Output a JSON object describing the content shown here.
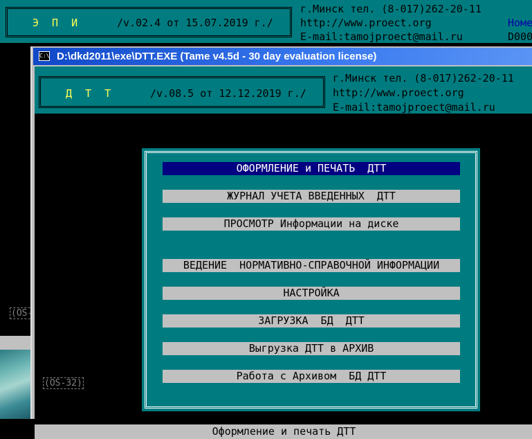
{
  "background_app": {
    "name": "Э П И",
    "version": "/v.02.4 от 15.07.2019 г./",
    "contact_lines": [
      "г.Минск тел. (8-017)262-20-11",
      "http://www.proect.org",
      "E-mail:tamojproect@mail.ru"
    ],
    "right_cut_1": "Номе",
    "right_cut_2": "D000",
    "os_label": "(OS-"
  },
  "window": {
    "title": "D:\\dkd2011\\exe\\DTT.EXE (Tame v4.5d - 30 day evaluation license)",
    "icon": "console-icon"
  },
  "app": {
    "name": "Д Т Т",
    "version": "/v.08.5 от 12.12.2019 г./",
    "contact_lines": [
      "г.Минск тел. (8-017)262-20-11",
      "http://www.proect.org",
      "E-mail:tamojproect@mail.ru"
    ],
    "os_label": "(OS-32)"
  },
  "menu": {
    "items": [
      {
        "label": "ОФОРМЛЕНИЕ и ПЕЧАТЬ  ДТТ",
        "selected": true
      },
      {
        "label": "ЖУРНАЛ УЧЕТА ВВЕДЕННЫХ  ДТТ",
        "selected": false
      },
      {
        "label": "ПРОСМОТР Информации на диске",
        "selected": false
      },
      {
        "label": "ВЕДЕНИЕ  НОРМАТИВНО-СПРАВОЧНОЙ ИНФОРМАЦИИ",
        "selected": false
      },
      {
        "label": "НАСТРОЙКА",
        "selected": false
      },
      {
        "label": "ЗАГРУЗКА  БД  ДТТ",
        "selected": false
      },
      {
        "label": "Выгрузка ДТТ в АРХИВ",
        "selected": false
      },
      {
        "label": "Работа с Архивом  БД ДТТ",
        "selected": false
      }
    ]
  },
  "status_bar": {
    "text": "Оформление и печать ДТТ"
  },
  "colors": {
    "teal": "#007c80",
    "yellow": "#ffff55",
    "selected": "#000080",
    "menu_gray": "#c0c0c0"
  }
}
